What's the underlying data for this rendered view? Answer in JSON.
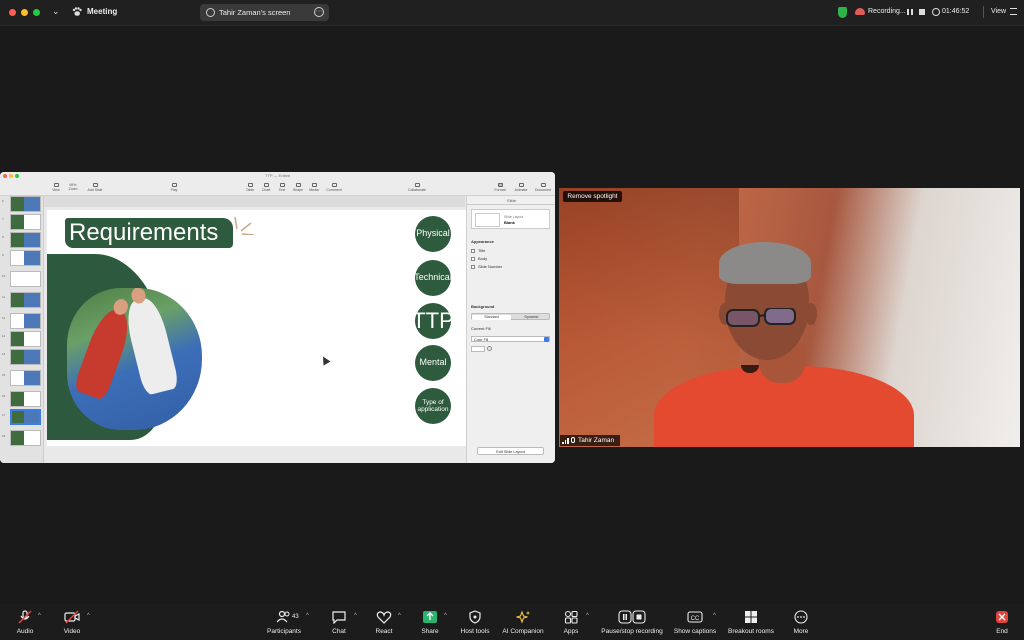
{
  "topbar": {
    "window_title": "Meeting",
    "share_label": "Tahir Zaman's screen",
    "recording_label": "Recording...",
    "elapsed_time": "01:46:52",
    "view_label": "View",
    "colors": {
      "recording": "#e25b5b",
      "shield": "#2db34a"
    }
  },
  "keynote": {
    "title": "TTP — Edited",
    "toolbar": [
      "View",
      "Zoom",
      "Add Slide",
      "Play",
      "Table",
      "Chart",
      "Text",
      "Shape",
      "Media",
      "Comment",
      "Collaborate",
      "Format",
      "Animate",
      "Document"
    ],
    "zoom_value": "69%",
    "slide": {
      "title": "Requirements",
      "circles": [
        "Physical",
        "Technical",
        "TTP",
        "Mental",
        "Type of application"
      ]
    },
    "inspector": {
      "tab": "Slide",
      "layout_label": "Slide Layout",
      "layout_value": "Blank",
      "appearance_heading": "Appearance",
      "appearance_options": [
        "Title",
        "Body",
        "Slide Number"
      ],
      "background_heading": "Background",
      "segment_standard": "Standard",
      "segment_dynamic": "Dynamic",
      "current_fill": "Current Fill",
      "fill_type": "Color Fill",
      "edit_layout_button": "Edit Slide Layout"
    },
    "slide_numbers": [
      "6",
      "7",
      "8",
      "9",
      "10",
      "11",
      "12",
      "13",
      "14",
      "15",
      "16",
      "17",
      "18"
    ]
  },
  "video": {
    "spotlight_label": "Remove spotlight",
    "participant_name": "Tahir Zaman"
  },
  "bottombar": {
    "audio": "Audio",
    "video": "Video",
    "participants": "Participants",
    "participant_count": "43",
    "chat": "Chat",
    "react": "React",
    "share": "Share",
    "host_tools": "Host tools",
    "ai_companion": "AI Companion",
    "apps": "Apps",
    "pause_stop_recording": "Pause/stop recording",
    "show_captions": "Show captions",
    "breakout_rooms": "Breakout rooms",
    "more": "More",
    "end": "End",
    "colors": {
      "share_green": "#2ab36f",
      "end_red": "#e2453c"
    }
  }
}
